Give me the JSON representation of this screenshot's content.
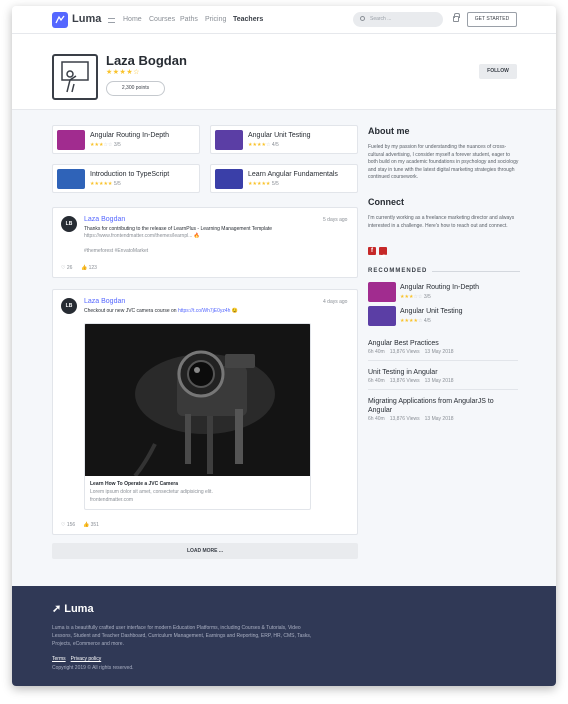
{
  "app": {
    "name": "Luma"
  },
  "nav": {
    "items": [
      "Home",
      "Courses",
      "Paths",
      "Pricing",
      "Teachers"
    ],
    "active": "Teachers"
  },
  "search": {
    "placeholder": "Search ..."
  },
  "header": {
    "get_started": "GET STARTED"
  },
  "profile": {
    "name": "Laza Bogdan",
    "stars": "★★★★☆",
    "points": "2,300 points",
    "follow_label": "FOLLOW"
  },
  "courses": [
    {
      "title": "Angular Routing In-Depth",
      "rating_text": "3/5",
      "stars_on": "★★★",
      "stars_off": "☆☆",
      "thumb_color": "#a12c8f"
    },
    {
      "title": "Angular Unit Testing",
      "rating_text": "4/5",
      "stars_on": "★★★★",
      "stars_off": "☆",
      "thumb_color": "#5b3ea5"
    },
    {
      "title": "Introduction to TypeScript",
      "rating_text": "5/5",
      "stars_on": "★★★★★",
      "stars_off": "",
      "thumb_color": "#2f63b8"
    },
    {
      "title": "Learn Angular Fundamentals",
      "rating_text": "5/5",
      "stars_on": "★★★★★",
      "stars_off": "",
      "thumb_color": "#3a3fa8"
    }
  ],
  "posts": [
    {
      "initials": "LB",
      "name": "Laza Bogdan",
      "date": "5 days ago",
      "text": "Thanks for contributing to the release of LearnPlus - Learning Management Template",
      "link": "https://www.frontendmatter.com/themes/learnpl... 🔥",
      "tags": "#themeforest #EnvatoMarket",
      "likes": "26",
      "shares": "123"
    },
    {
      "initials": "LB",
      "name": "Laza Bogdan",
      "date": "4 days ago",
      "text_prefix": "Checkout our new JVC camera course on",
      "text_link": "https://t.co/Wh7jE0yz4h 😉",
      "preview_title": "Learn How To Operate a JVC Camera",
      "preview_desc": "Lorem ipsum dolor sit amet, consectetur adipisicing elit.",
      "preview_domain": "frontendmatter.com",
      "likes": "156",
      "shares": "351"
    }
  ],
  "load_more": "LOAD MORE ...",
  "about": {
    "title": "About me",
    "text": "Fueled by my passion for understanding the nuances of cross-cultural advertising, I consider myself a forever student, eager to both build on my academic foundations in psychology and sociology and stay in tune with the latest digital marketing strategies through continued coursework."
  },
  "connect": {
    "title": "Connect",
    "text": "I'm currently working as a freelance marketing director and always interested in a challenge. Here's how to reach out and connect."
  },
  "recommended": {
    "title": "RECOMMENDED",
    "courses": [
      {
        "title": "Angular Routing In-Depth",
        "rating_text": "3/5",
        "stars_on": "★★★",
        "stars_off": "☆☆",
        "thumb_color": "#a12c8f"
      },
      {
        "title": "Angular Unit Testing",
        "rating_text": "4/5",
        "stars_on": "★★★★",
        "stars_off": "☆",
        "thumb_color": "#5b3ea5"
      }
    ],
    "lessons": [
      {
        "title": "Angular Best Practices",
        "duration": "6h 40m",
        "views": "13,876 Views",
        "date": "13 May 2018"
      },
      {
        "title": "Unit Testing in Angular",
        "duration": "6h 40m",
        "views": "13,876 Views",
        "date": "13 May 2018"
      },
      {
        "title": "Migrating Applications from AngularJS to Angular",
        "duration": "6h 40m",
        "views": "13,876 Views",
        "date": "13 May 2018"
      }
    ]
  },
  "footer": {
    "logo": "Luma",
    "description": "Luma is a beautifully crafted user interface for modern Education Platforms, including Courses & Tutorials, Video Lessons, Student and Teacher Dashboard, Curriculum Management, Earnings and Reporting, ERP, HR, CMS, Tasks, Projects, eCommerce and more.",
    "links": [
      "Terms",
      "Privacy policy"
    ],
    "copyright": "Copyright 2019 © All rights reserved."
  },
  "colors": {
    "accent": "#5567ff",
    "footer_bg": "#303956",
    "star": "#f9c32c",
    "social": "#c62828"
  }
}
